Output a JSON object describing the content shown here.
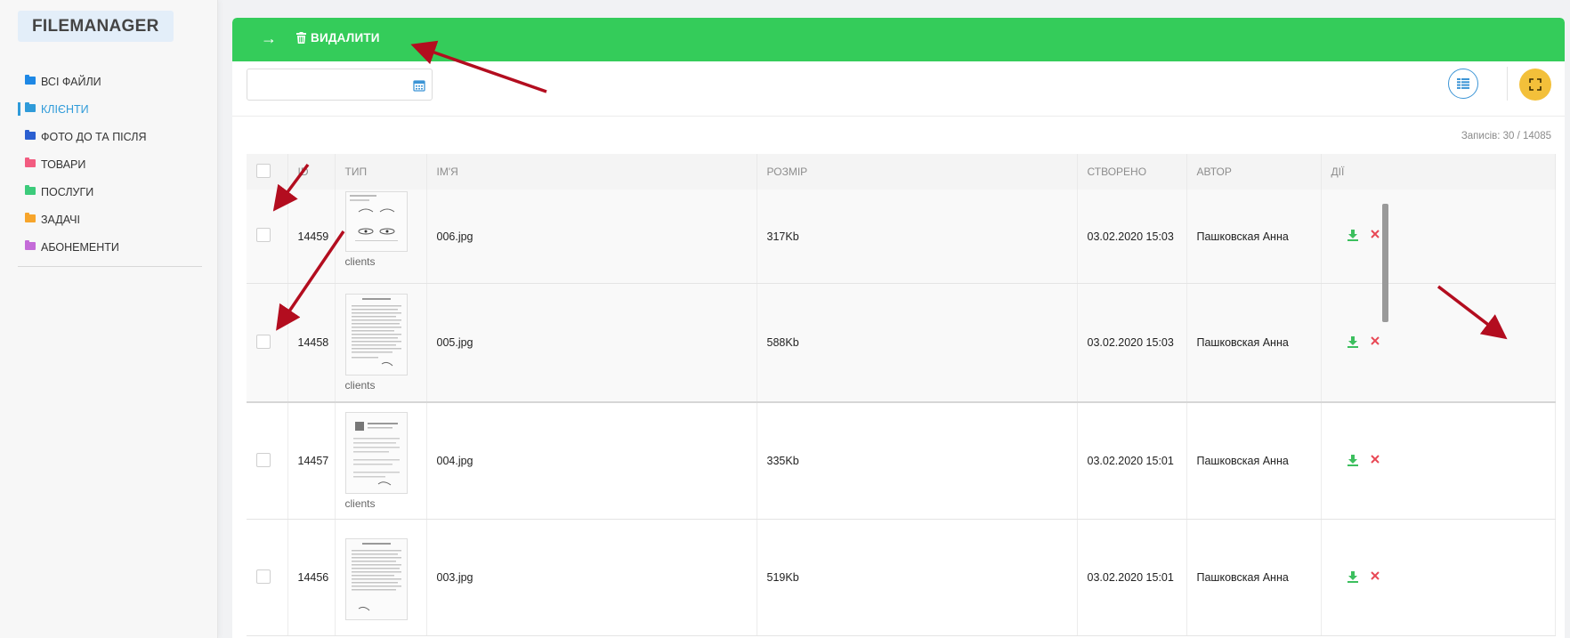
{
  "app": {
    "brand": "FILEMANAGER"
  },
  "sidebar": {
    "items": [
      {
        "label": "ВСІ ФАЙЛИ",
        "color": "#1e88e5",
        "active": false
      },
      {
        "label": "КЛІЄНТИ",
        "color": "#2f9bd9",
        "active": true
      },
      {
        "label": "ФОТО ДО ТА ПІСЛЯ",
        "color": "#2b5fd0",
        "active": false
      },
      {
        "label": "ТОВАРИ",
        "color": "#f25c80",
        "active": false
      },
      {
        "label": "ПОСЛУГИ",
        "color": "#3ccb7b",
        "active": false
      },
      {
        "label": "ЗАДАЧІ",
        "color": "#f7a52b",
        "active": false
      },
      {
        "label": "АБОНЕМЕНТИ",
        "color": "#c46bd8",
        "active": false
      }
    ]
  },
  "toolbar": {
    "arrow_glyph": "→",
    "delete_label": "ВИДАЛИТИ",
    "date_placeholder": "",
    "accent_color": "#34cc5a"
  },
  "records": {
    "text": "Записів: 30 / 14085"
  },
  "table": {
    "headers": [
      "ID",
      "ТИП",
      "ІМ'Я",
      "РОЗМІР",
      "СТВОРЕНО",
      "АВТОР",
      "ДІЇ"
    ],
    "rows": [
      {
        "id": "14459",
        "type": "clients",
        "name": "006.jpg",
        "size": "317Kb",
        "created": "03.02.2020 15:03",
        "author": "Пашковская Анна"
      },
      {
        "id": "14458",
        "type": "clients",
        "name": "005.jpg",
        "size": "588Kb",
        "created": "03.02.2020 15:03",
        "author": "Пашковская Анна"
      },
      {
        "id": "14457",
        "type": "clients",
        "name": "004.jpg",
        "size": "335Kb",
        "created": "03.02.2020 15:01",
        "author": "Пашковская Анна"
      },
      {
        "id": "14456",
        "type": "",
        "name": "003.jpg",
        "size": "519Kb",
        "created": "03.02.2020 15:01",
        "author": "Пашковская Анна"
      }
    ]
  },
  "icons": {
    "download": "download-icon",
    "delete": "close-icon",
    "calendar": "calendar-icon",
    "view": "list-view-icon",
    "fullscreen": "fullscreen-icon"
  }
}
